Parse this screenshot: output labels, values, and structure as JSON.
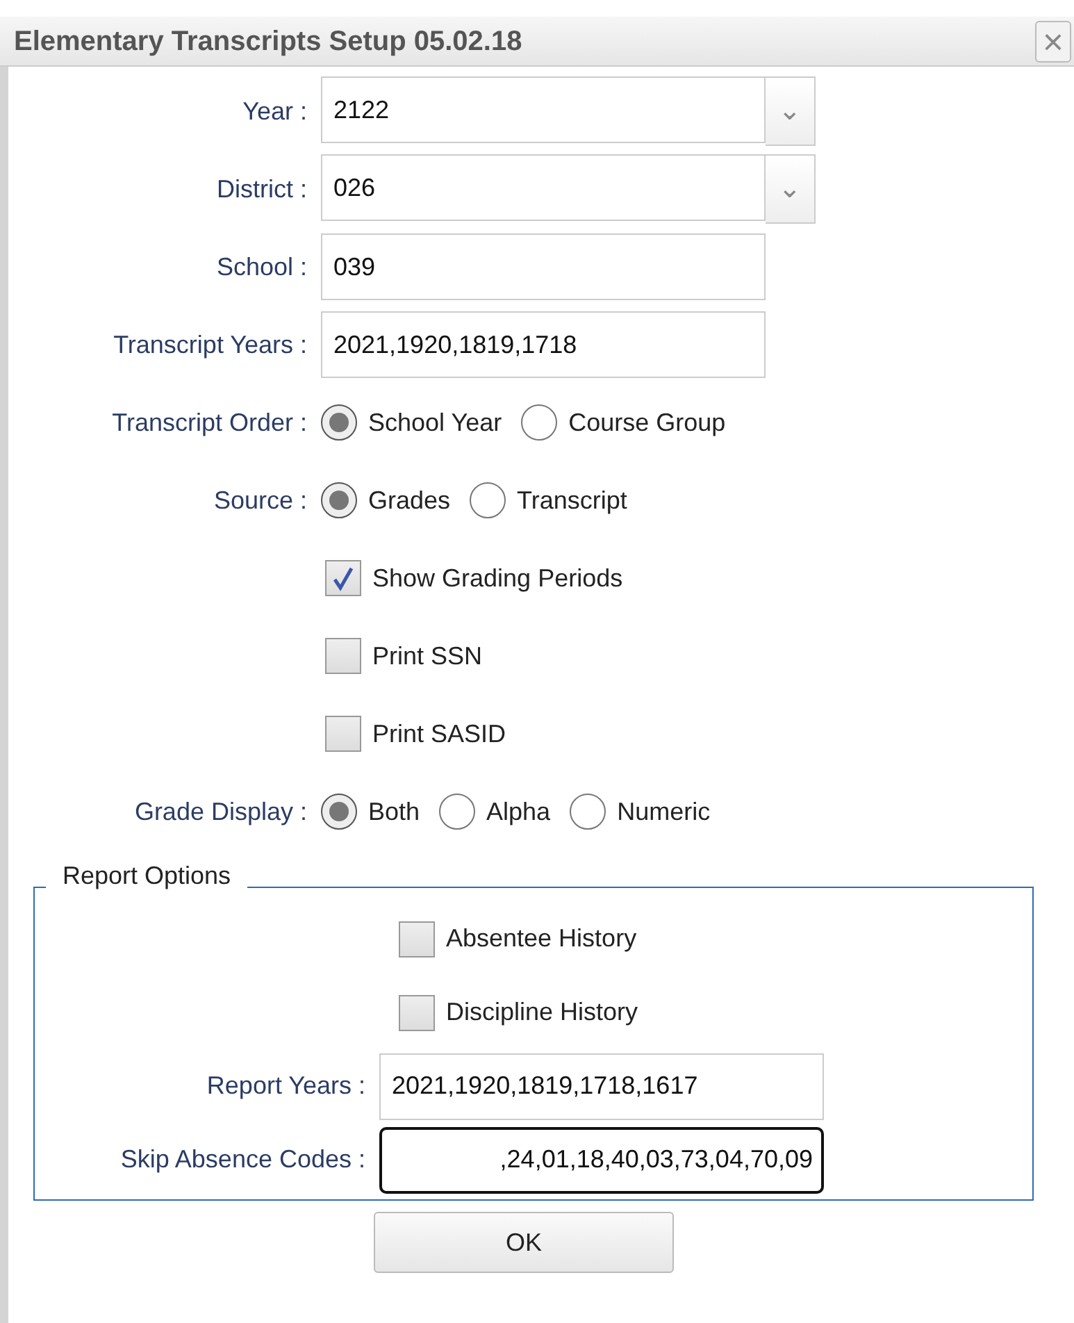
{
  "window": {
    "title": "Elementary Transcripts Setup 05.02.18",
    "close": "×"
  },
  "fields": [
    {
      "kind": "select",
      "label": "Year :",
      "value": "2122",
      "caret": "⌄"
    },
    {
      "kind": "select",
      "label": "District :",
      "value": "026",
      "caret": "⌄"
    },
    {
      "kind": "text",
      "label": "School :",
      "value": "039"
    },
    {
      "kind": "text",
      "label": "Transcript Years :",
      "value": "2021,1920,1819,1718"
    },
    {
      "kind": "radio",
      "label": "Transcript Order :",
      "options": [
        {
          "label": "School Year",
          "selected": true
        },
        {
          "label": "Course Group",
          "selected": false
        }
      ]
    },
    {
      "kind": "radio",
      "label": "Source :",
      "options": [
        {
          "label": "Grades",
          "selected": true
        },
        {
          "label": "Transcript",
          "selected": false
        }
      ]
    },
    {
      "kind": "checkbox",
      "label": "Show Grading Periods",
      "checked": true
    },
    {
      "kind": "checkbox",
      "label": "Print SSN",
      "checked": false
    },
    {
      "kind": "checkbox",
      "label": "Print SASID",
      "checked": false
    },
    {
      "kind": "radio",
      "label": "Grade Display :",
      "options": [
        {
          "label": "Both",
          "selected": true
        },
        {
          "label": "Alpha",
          "selected": false
        },
        {
          "label": "Numeric",
          "selected": false
        }
      ]
    }
  ],
  "report_options": {
    "legend": "Report Options",
    "fields": [
      {
        "kind": "checkbox",
        "label": "Absentee History",
        "checked": false
      },
      {
        "kind": "checkbox",
        "label": "Discipline History",
        "checked": false
      },
      {
        "kind": "text",
        "label": "Report Years :",
        "value": "2021,1920,1819,1718,1617"
      },
      {
        "kind": "text",
        "label": "Skip Absence Codes :",
        "value": ",24,01,18,40,03,73,04,70,09",
        "focused": true
      }
    ]
  },
  "ok_button": "OK"
}
